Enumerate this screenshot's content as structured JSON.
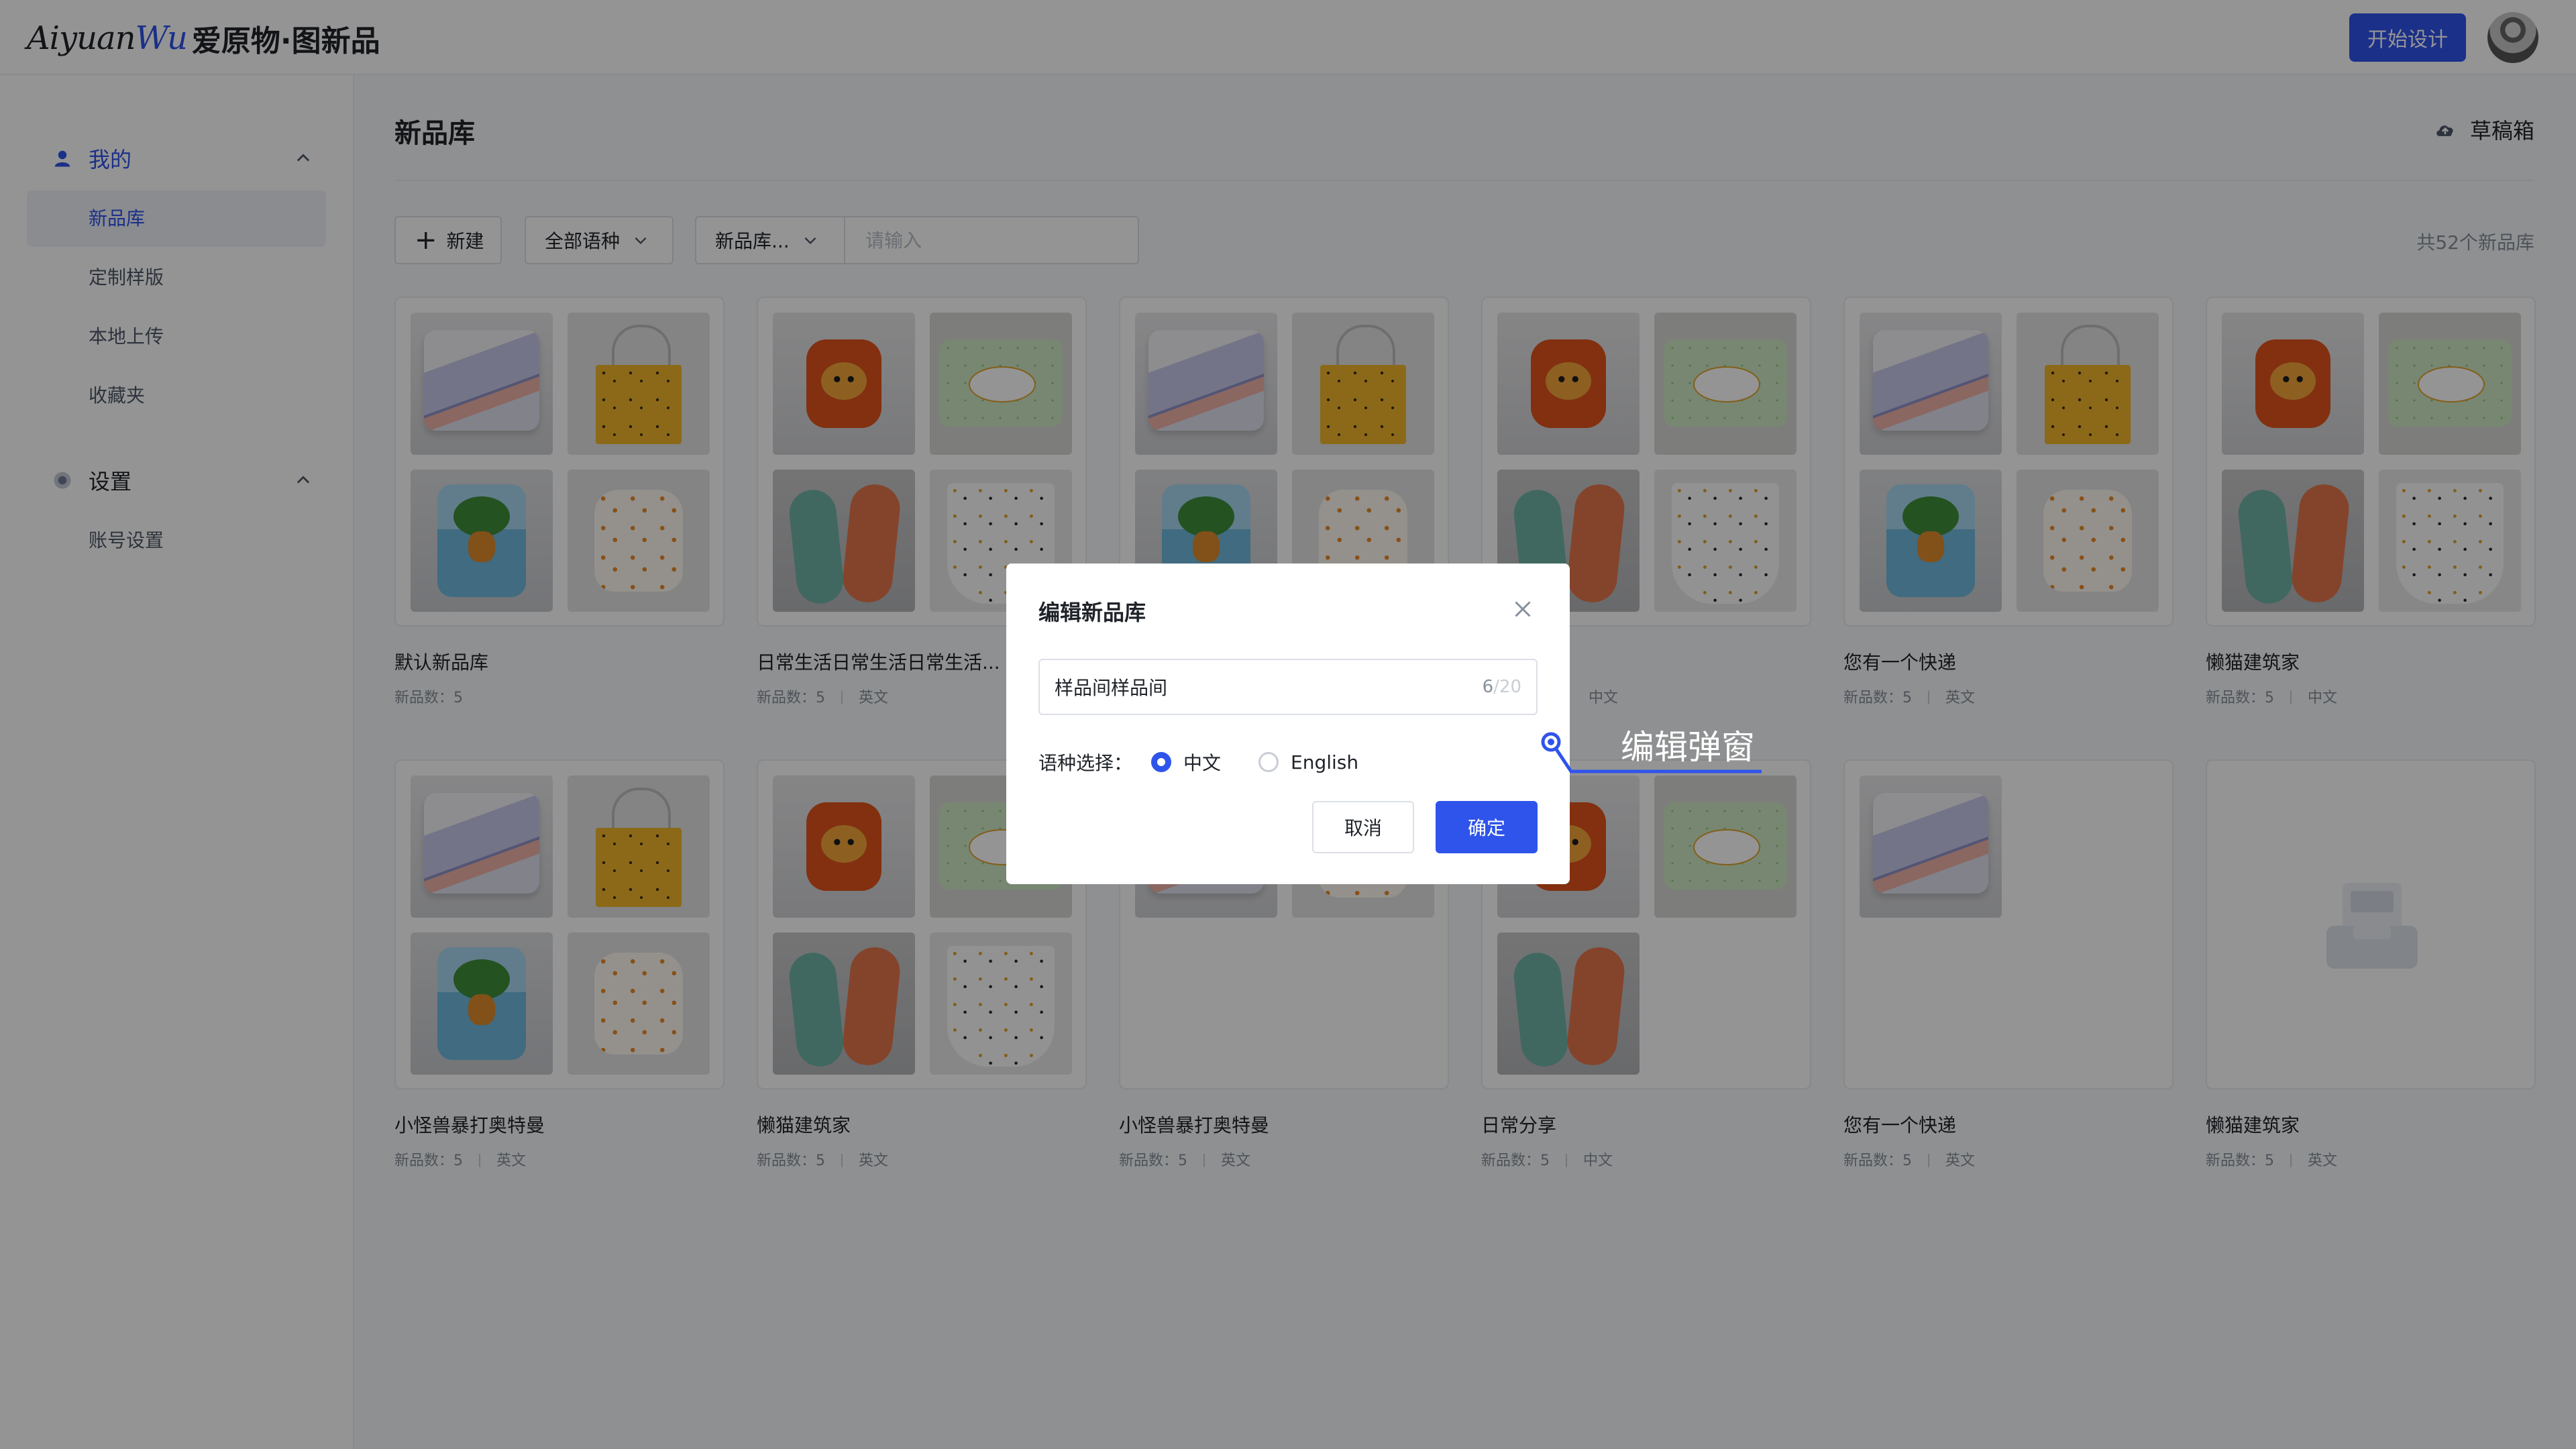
{
  "header": {
    "logo_latin": "Aiyuan",
    "logo_accent": "Wu",
    "logo_cn": "爱原物·图新品",
    "start_button": "开始设计"
  },
  "sidebar": {
    "groups": [
      {
        "label": "我的",
        "icon": "user-icon",
        "items": [
          "新品库",
          "定制样版",
          "本地上传",
          "收藏夹"
        ]
      },
      {
        "label": "设置",
        "icon": "settings-icon",
        "items": [
          "账号设置"
        ]
      }
    ],
    "active_item": "新品库"
  },
  "main": {
    "title": "新品库",
    "draft_label": "草稿箱",
    "toolbar": {
      "new_label": "新建",
      "language_filter": "全部语种",
      "category_filter": "新品库...",
      "search_placeholder": "请输入"
    },
    "total_label": "共52个新品库",
    "meta_label": "新品数：",
    "cards": [
      {
        "name": "默认新品库",
        "count": "5",
        "lang": ""
      },
      {
        "name": "日常生活日常生活日常生活...",
        "count": "5",
        "lang": "英文"
      },
      {
        "name": "",
        "count": "",
        "lang": ""
      },
      {
        "name": "",
        "count": "",
        "lang": "中文"
      },
      {
        "name": "您有一个快递",
        "count": "5",
        "lang": "英文"
      },
      {
        "name": "懒猫建筑家",
        "count": "5",
        "lang": "中文"
      },
      {
        "name": "小怪兽暴打奥特曼",
        "count": "5",
        "lang": "英文"
      },
      {
        "name": "懒猫建筑家",
        "count": "5",
        "lang": "英文"
      },
      {
        "name": "小怪兽暴打奥特曼",
        "count": "5",
        "lang": "英文"
      },
      {
        "name": "日常分享",
        "count": "5",
        "lang": "中文"
      },
      {
        "name": "您有一个快递",
        "count": "5",
        "lang": "英文"
      },
      {
        "name": "懒猫建筑家",
        "count": "5",
        "lang": "英文"
      }
    ]
  },
  "modal": {
    "title": "编辑新品库",
    "name_value": "样品间样品间",
    "char_count": "6",
    "char_max": "/20",
    "language_label": "语种选择：",
    "options": [
      {
        "label": "中文",
        "checked": true
      },
      {
        "label": "English",
        "checked": false
      }
    ],
    "cancel_label": "取消",
    "confirm_label": "确定"
  },
  "annotation": {
    "text": "编辑弹窗"
  }
}
